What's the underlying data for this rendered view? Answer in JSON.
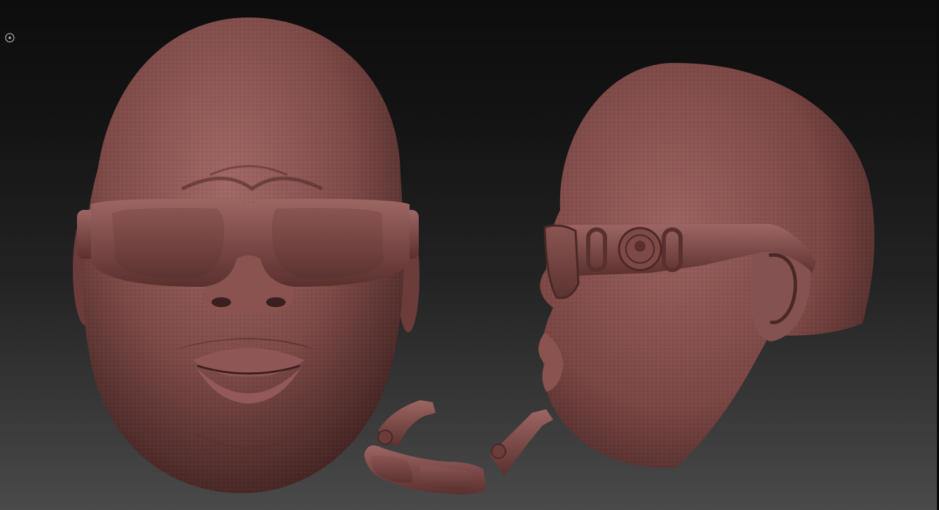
{
  "app": {
    "viewport_name": "3d-sculpt-canvas"
  },
  "indicator": {
    "icon": "circle-dot-icon"
  },
  "scene": {
    "material_color": "#7a4a47",
    "material_highlight": "#a26966",
    "material_shadow": "#3e2120",
    "objects": [
      {
        "name": "front-head-sculpt",
        "icon": "head-front"
      },
      {
        "name": "side-head-sculpt",
        "icon": "head-profile"
      },
      {
        "name": "sunglasses-sculpt",
        "icon": "sunglasses"
      }
    ]
  },
  "colors": {
    "bg_top": "#0d0d0d",
    "bg_bottom": "#4a4a4a"
  }
}
